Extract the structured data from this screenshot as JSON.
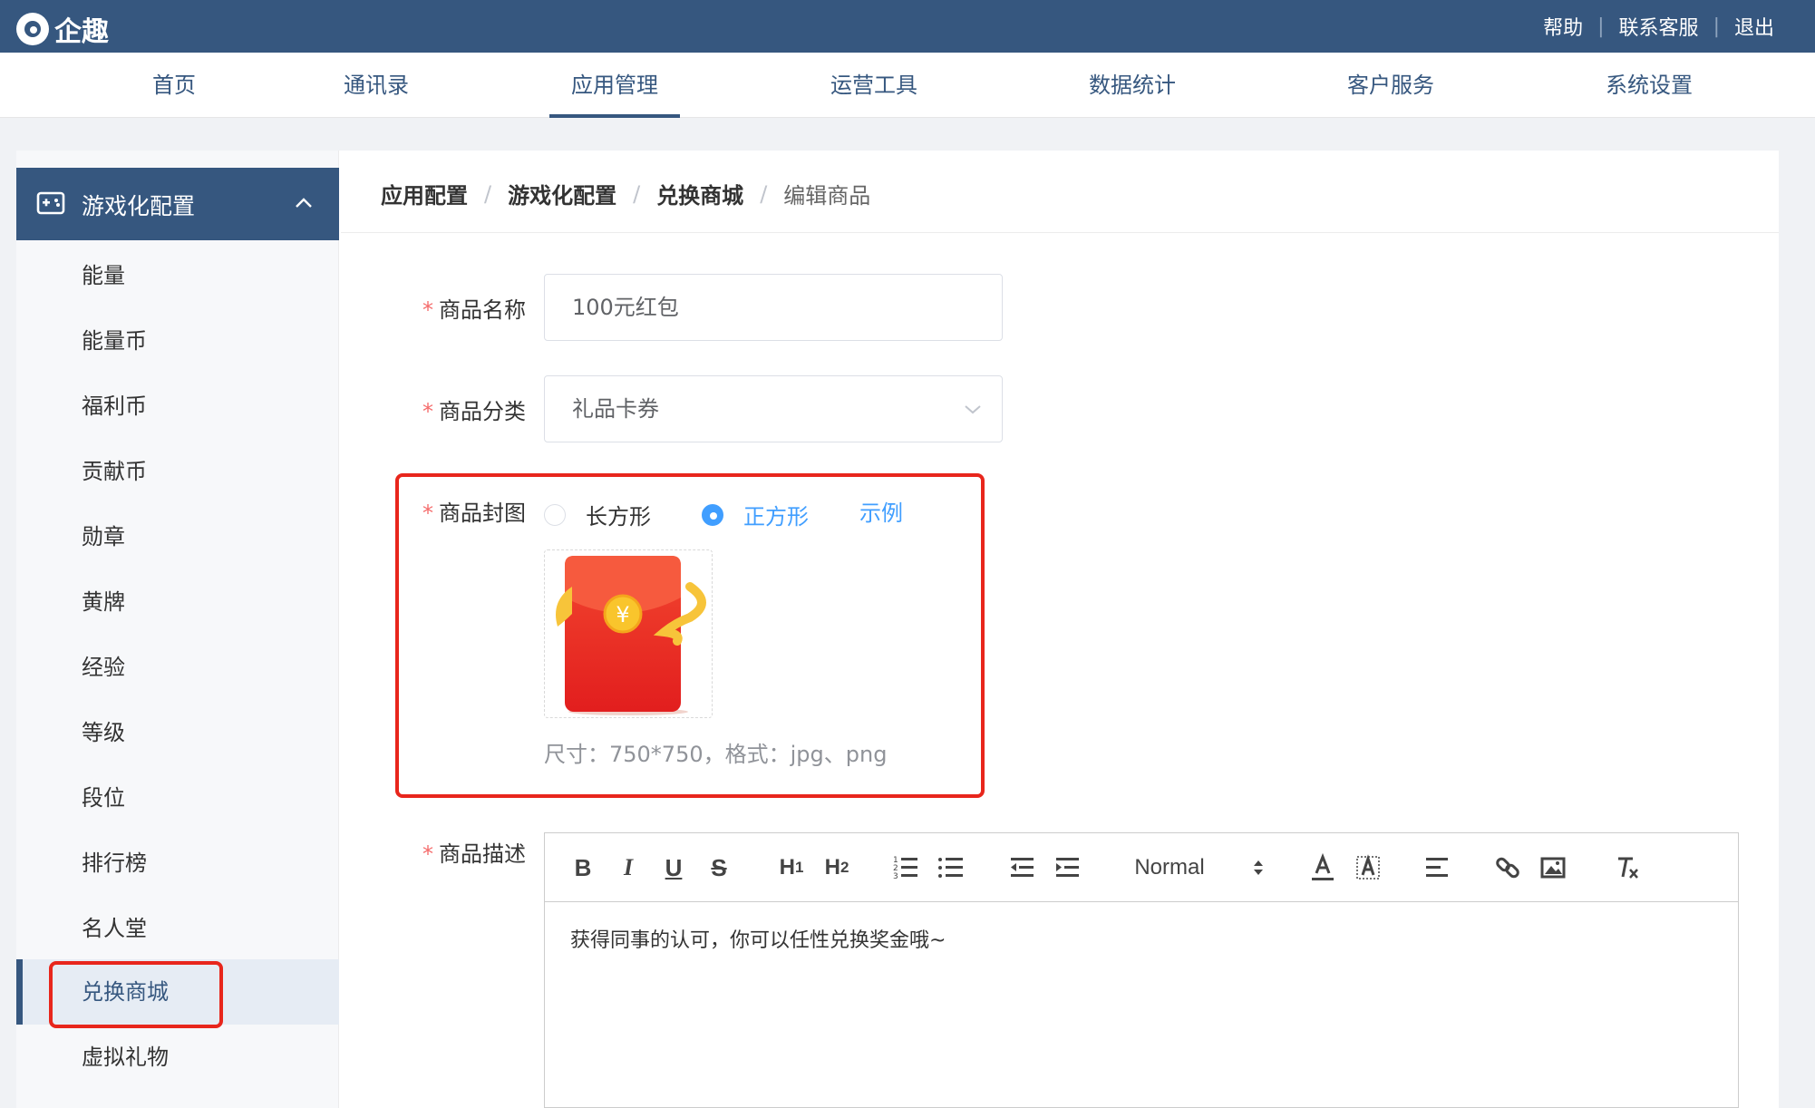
{
  "app": {
    "name": "企趣"
  },
  "header": {
    "links": [
      "帮助",
      "联系客服",
      "退出"
    ]
  },
  "nav": {
    "items": [
      "首页",
      "通讯录",
      "应用管理",
      "运营工具",
      "数据统计",
      "客户服务",
      "系统设置"
    ],
    "active": "应用管理"
  },
  "sidebar": {
    "group_title": "游戏化配置",
    "items": [
      "能量",
      "能量币",
      "福利币",
      "贡献币",
      "勋章",
      "黄牌",
      "经验",
      "等级",
      "段位",
      "排行榜",
      "名人堂",
      "兑换商城",
      "虚拟礼物"
    ],
    "active": "兑换商城"
  },
  "breadcrumb": {
    "items": [
      "应用配置",
      "游戏化配置",
      "兑换商城"
    ],
    "sep": "/",
    "current": "编辑商品"
  },
  "form": {
    "required_mark": "*",
    "name_label": "商品名称",
    "name_value": "100元红包",
    "category_label": "商品分类",
    "category_value": "礼品卡券",
    "cover_label": "商品封图",
    "cover_options": [
      "长方形",
      "正方形"
    ],
    "cover_selected": "正方形",
    "example_link": "示例",
    "cover_hint": "尺寸：750*750，格式：jpg、png",
    "desc_label": "商品描述",
    "desc_value": "获得同事的认可，你可以任性兑换奖金哦~",
    "cover_image_text": "¥"
  },
  "editor_toolbar": {
    "bold": "B",
    "italic": "I",
    "underline": "U",
    "strike": "S",
    "h1": "H",
    "h1_sub": "1",
    "h2": "H",
    "h2_sub": "2",
    "format_select": "Normal"
  },
  "colors": {
    "primary": "#36577f",
    "link": "#409eff",
    "required": "#f56c6c",
    "highlight": "#e8261c"
  }
}
